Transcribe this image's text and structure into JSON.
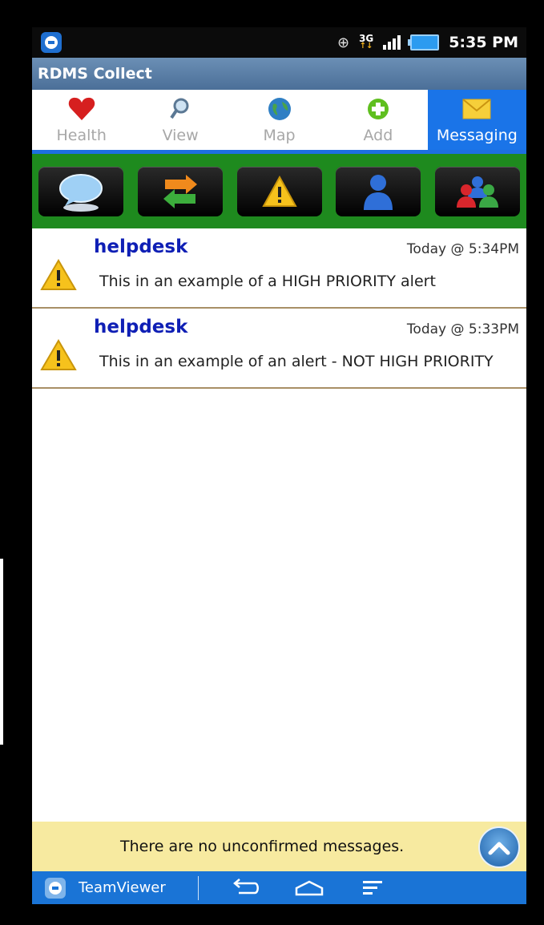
{
  "status_bar": {
    "time": "5:35 PM",
    "network": "3G",
    "icons": [
      "teamviewer-icon",
      "gps-icon",
      "network-3g-icon",
      "signal-icon",
      "battery-icon"
    ]
  },
  "app": {
    "title": "RDMS Collect"
  },
  "tabs": [
    {
      "label": "Health",
      "icon": "heart-icon",
      "active": false
    },
    {
      "label": "View",
      "icon": "magnifier-icon",
      "active": false
    },
    {
      "label": "Map",
      "icon": "globe-icon",
      "active": false
    },
    {
      "label": "Add",
      "icon": "plus-icon",
      "active": false
    },
    {
      "label": "Messaging",
      "icon": "envelope-icon",
      "active": true
    }
  ],
  "toolbar": {
    "buttons": [
      "chat-bubble-icon",
      "refresh-icon",
      "warning-icon",
      "user-icon",
      "group-icon"
    ]
  },
  "messages": [
    {
      "sender": "helpdesk",
      "time": "Today @ 5:34PM",
      "text": "This in an example of a HIGH PRIORITY alert",
      "icon": "warning-icon"
    },
    {
      "sender": "helpdesk",
      "time": "Today @ 5:33PM",
      "text": "This in an example of an alert - NOT HIGH PRIORITY",
      "icon": "warning-icon"
    }
  ],
  "notice": {
    "text": "There are no unconfirmed messages."
  },
  "bottom_bar": {
    "app_label": "TeamViewer"
  },
  "colors": {
    "tab_active": "#1a74e8",
    "toolbar_bg": "#1e8a1e",
    "sender": "#0f1fb5",
    "notice_bg": "#f7eaa0",
    "bottom_bar": "#1a74d6"
  }
}
